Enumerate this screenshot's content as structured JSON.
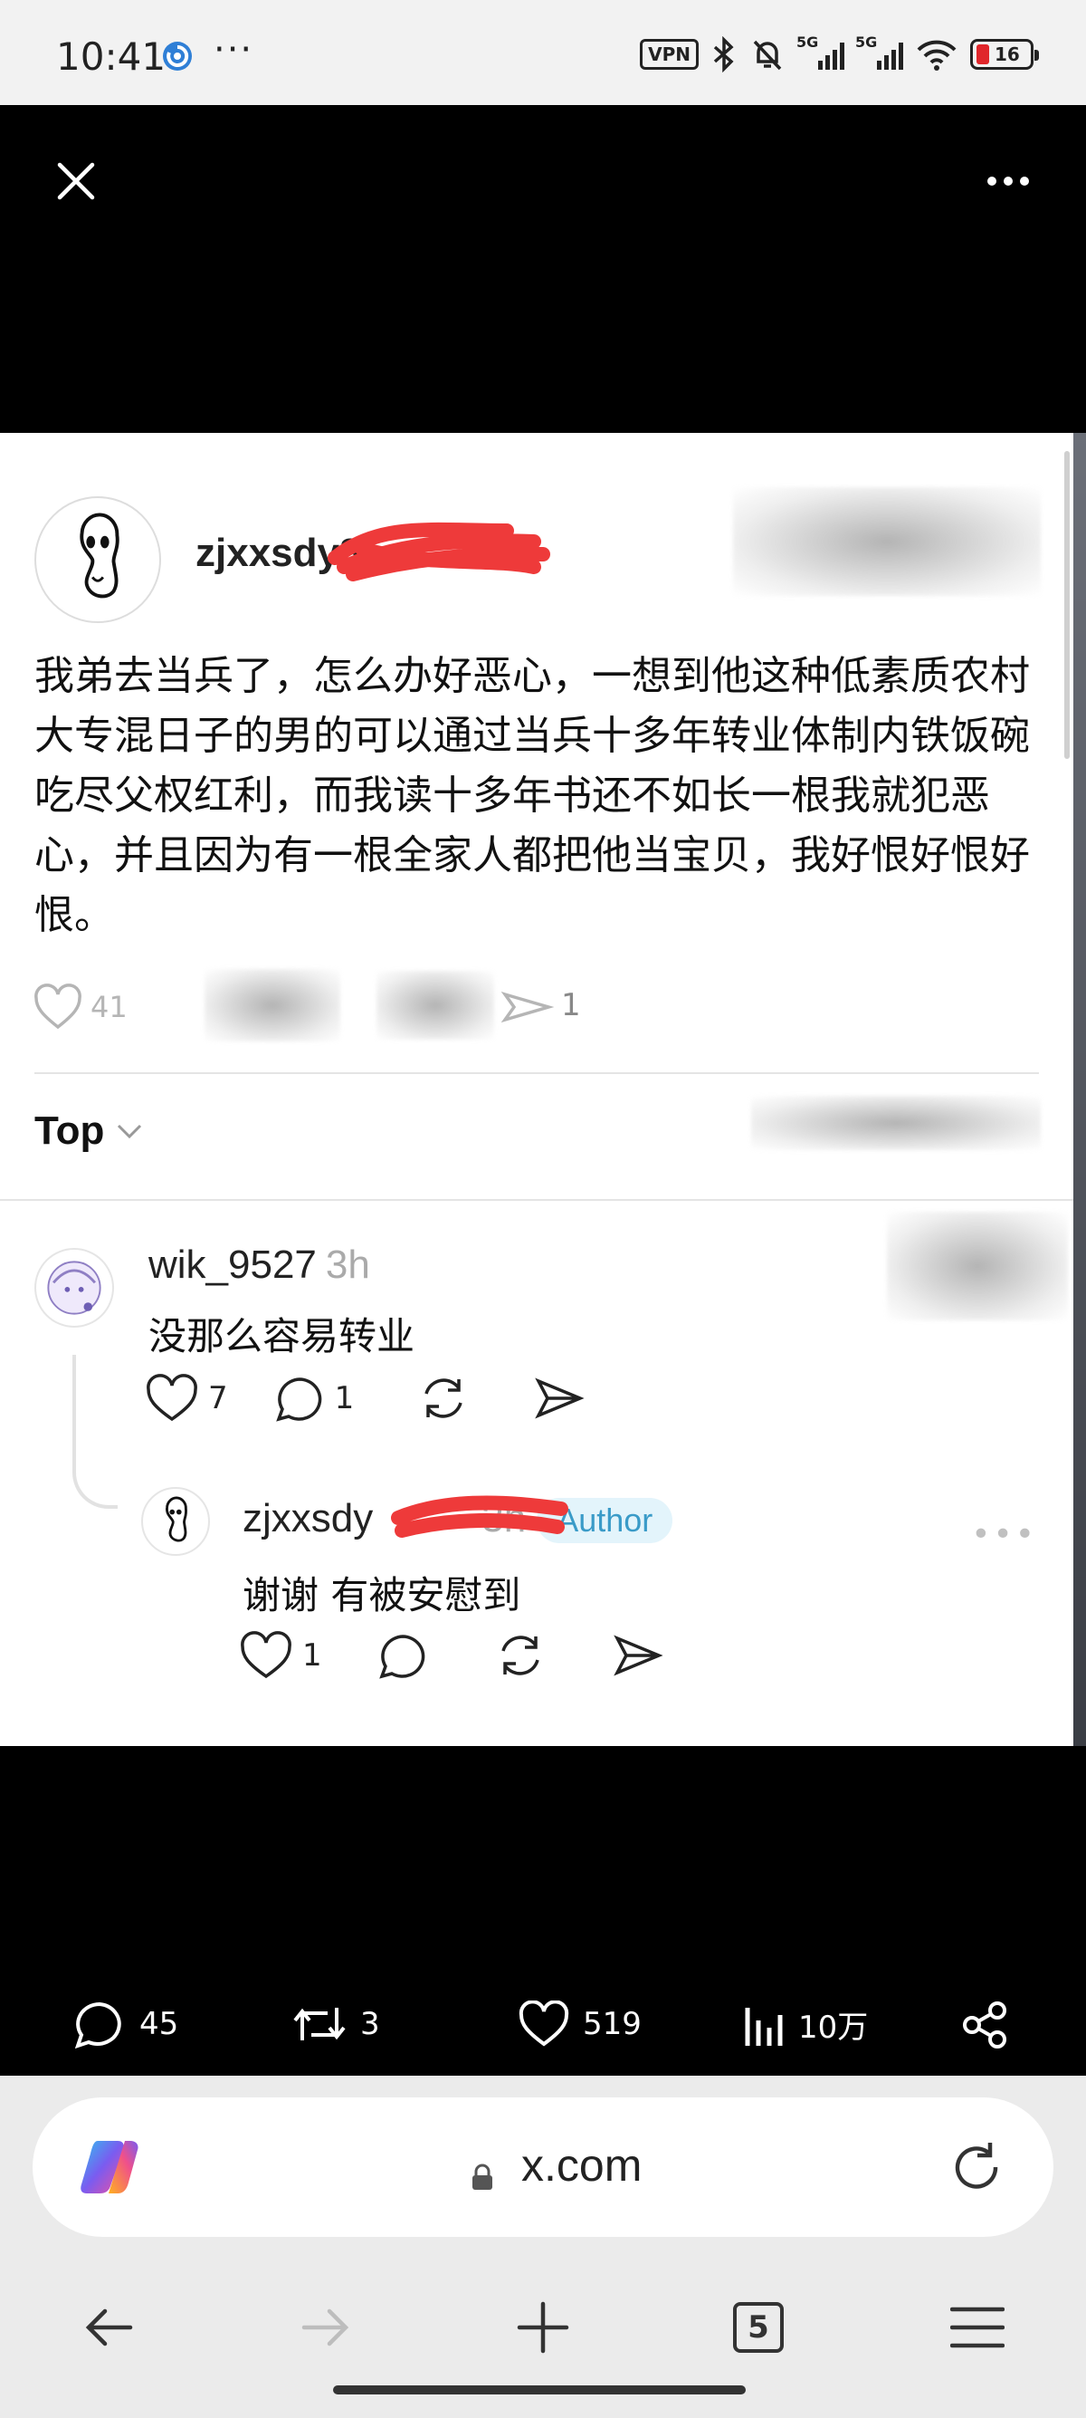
{
  "status_bar": {
    "time": "10:41",
    "more": "···",
    "vpn": "VPN",
    "signal_1": "5G",
    "signal_2": "5G",
    "battery": "16"
  },
  "post": {
    "username": "zjxxsdy8",
    "text": "我弟去当兵了，怎么办好恶心，一想到他这种低素质农村大专混日子的男的可以通过当兵十多年转业体制内铁饭碗吃尽父权红利，而我读十多年书还不如长一根我就犯恶心，并且因为有一根全家人都把他当宝贝，我好恨好恨好恨。",
    "likes": "41",
    "shares": "1"
  },
  "sort": {
    "label": "Top"
  },
  "comments": [
    {
      "username": "wik_9527",
      "time": "3h",
      "text": "没那么容易转业",
      "likes": "7",
      "replies": "1"
    },
    {
      "username": "zjxxsdy",
      "time": "3h",
      "badge": "Author",
      "text": "谢谢 有被安慰到",
      "likes": "1"
    }
  ],
  "tweet_stats": {
    "replies": "45",
    "retweets": "3",
    "likes": "519",
    "views": "10万"
  },
  "browser": {
    "url": "x.com",
    "tab_count": "5"
  }
}
